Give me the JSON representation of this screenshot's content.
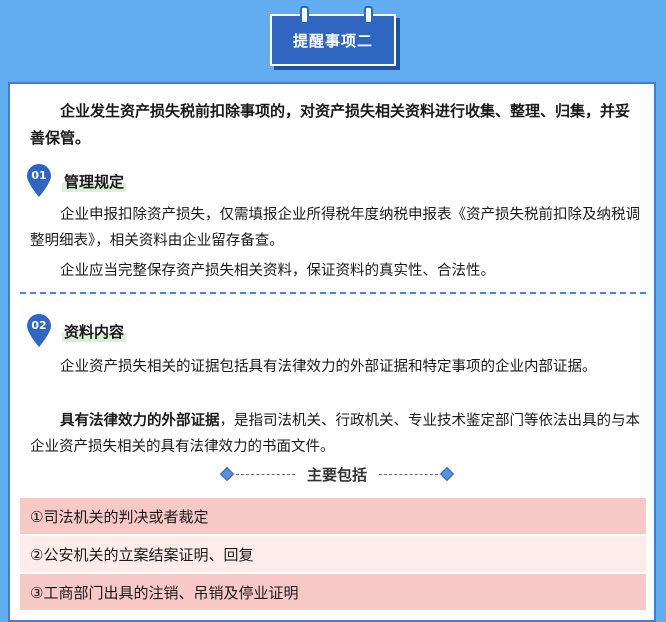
{
  "header": {
    "title": "提醒事项二"
  },
  "intro": "企业发生资产损失税前扣除事项的，对资产损失相关资料进行收集、整理、归集，并妥善保管。",
  "section1": {
    "number": "01",
    "title": "管理规定",
    "paragraphs": [
      "企业申报扣除资产损失，仅需填报企业所得税年度纳税申报表《资产损失税前扣除及纳税调整明细表》，相关资料由企业留存备查。",
      "企业应当完整保存资产损失相关资料，保证资料的真实性、合法性。"
    ]
  },
  "section2": {
    "number": "02",
    "title": "资料内容",
    "paragraph1": "企业资产损失相关的证据包括具有法律效力的外部证据和特定事项的企业内部证据。",
    "paragraph2_bold": "具有法律效力的外部证据",
    "paragraph2_rest": "，是指司法机关、行政机关、专业技术鉴定部门等依法出具的与本企业资产损失相关的具有法律效力的书面文件。",
    "subheading": "主要包括",
    "items": [
      "①司法机关的判决或者裁定",
      "②公安机关的立案结案证明、回复",
      "③工商部门出具的注销、吊销及停业证明"
    ]
  },
  "colors": {
    "background": "#62acf0",
    "tab": "#2f66c2",
    "card_border": "#3d7fd8",
    "list_dark": "#f7c9c6",
    "list_light": "#fdecea"
  }
}
